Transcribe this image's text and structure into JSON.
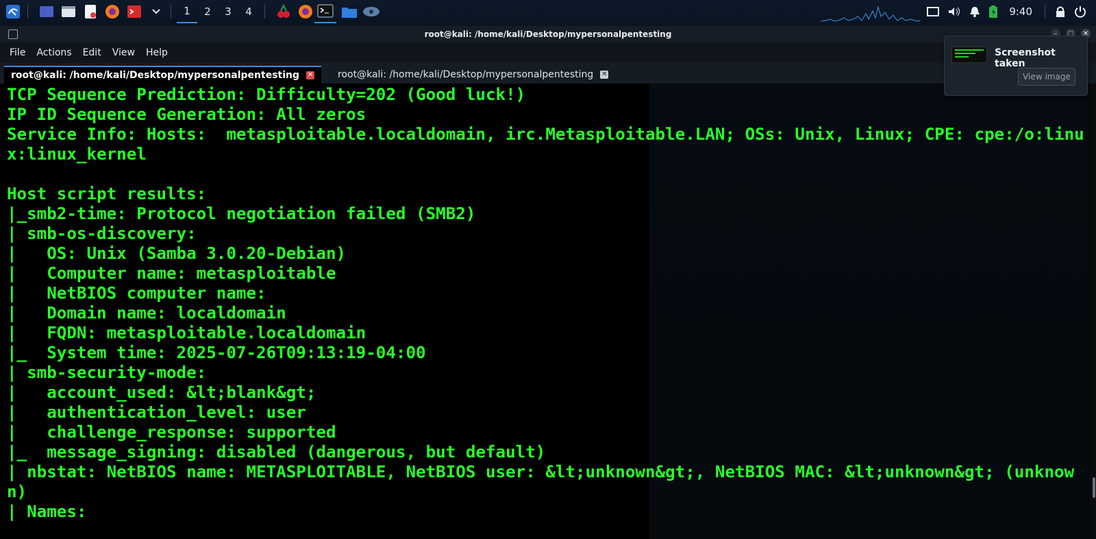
{
  "panel": {
    "workspaces": [
      "1",
      "2",
      "3",
      "4"
    ],
    "active_workspace": "1",
    "clock": "9:40",
    "launchers": [
      "kali-menu-icon",
      "desktop-icon",
      "file-manager-icon",
      "text-editor-icon",
      "firefox-icon",
      "terminal-red-icon",
      "chevron-down-icon",
      "cherrytree-icon",
      "firefox-icon",
      "terminal-icon",
      "folder-icon",
      "eye-icon"
    ],
    "tray": [
      "screen-icon",
      "volume-icon",
      "bell-icon",
      "battery-icon",
      "lock-icon",
      "power-icon"
    ]
  },
  "window": {
    "title": "root@kali: /home/kali/Desktop/mypersonalpentesting",
    "menu": [
      "File",
      "Actions",
      "Edit",
      "View",
      "Help"
    ],
    "tabs": [
      {
        "label": "root@kali: /home/kali/Desktop/mypersonalpentesting",
        "active": true
      },
      {
        "label": "root@kali: /home/kali/Desktop/mypersonalpentesting",
        "active": false
      }
    ]
  },
  "terminal": {
    "lines": [
      "TCP Sequence Prediction: Difficulty=202 (Good luck!)",
      "IP ID Sequence Generation: All zeros",
      "Service Info: Hosts:  metasploitable.localdomain, irc.Metasploitable.LAN; OSs: Unix, Linux; CPE: cpe:/o:linux:linux_kernel",
      "",
      "Host script results:",
      "|_smb2-time: Protocol negotiation failed (SMB2)",
      "| smb-os-discovery:",
      "|   OS: Unix (Samba 3.0.20-Debian)",
      "|   Computer name: metasploitable",
      "|   NetBIOS computer name:",
      "|   Domain name: localdomain",
      "|   FQDN: metasploitable.localdomain",
      "|_  System time: 2025-07-26T09:13:19-04:00",
      "| smb-security-mode:",
      "|   account_used: &lt;blank&gt;",
      "|   authentication_level: user",
      "|   challenge_response: supported",
      "|_  message_signing: disabled (dangerous, but default)",
      "| nbstat: NetBIOS name: METASPLOITABLE, NetBIOS user: &lt;unknown&gt;, NetBIOS MAC: &lt;unknown&gt; (unknown)",
      "| Names:"
    ]
  },
  "notification": {
    "title": "Screenshot taken",
    "button": "View image"
  }
}
